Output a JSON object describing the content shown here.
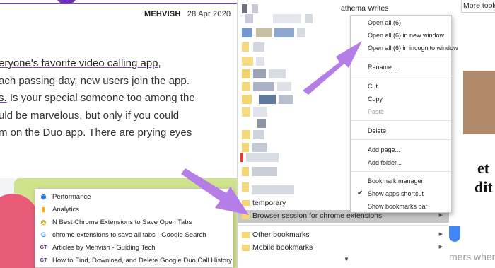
{
  "article": {
    "author": "MEHVISH",
    "date": "28 Apr 2020",
    "lines": [
      "eryone's favorite video calling app,",
      "ach passing day, new users join the app.",
      "s. Is your special someone too among the",
      "uld be marvelous, but only if you could",
      "m on the Duo app. There are prying eyes"
    ]
  },
  "bookmarks_panel": {
    "top_item": "athema Writes",
    "temporary": "temporary",
    "selected_folder": "Browser session for chrome extensions",
    "other": "Other bookmarks",
    "mobile": "Mobile bookmarks",
    "more_arrow": "▼"
  },
  "right_strip": {
    "more_tools": "More tools",
    "big1": "et",
    "big2": "dit",
    "bottom": "mers when"
  },
  "context_menu": {
    "open_all": "Open all (6)",
    "open_all_window": "Open all (6) in new window",
    "open_all_incognito": "Open all (6) in incognito window",
    "rename": "Rename...",
    "cut": "Cut",
    "copy": "Copy",
    "paste": "Paste",
    "delete": "Delete",
    "add_page": "Add page...",
    "add_folder": "Add folder...",
    "bookmark_manager": "Bookmark manager",
    "show_apps_shortcut": "Show apps shortcut",
    "show_apps_checked": "✔",
    "show_bookmarks_bar": "Show bookmarks bar"
  },
  "flyout": {
    "items": [
      {
        "label": "Performance",
        "icon": "performance-icon",
        "glyph": "◉",
        "color": "#1a73e8"
      },
      {
        "label": "Analytics",
        "icon": "analytics-icon",
        "glyph": "▮",
        "color": "#f9ab00"
      },
      {
        "label": "N Best Chrome Extensions to Save Open Tabs",
        "icon": "guiding-tech-icon",
        "glyph": "◎",
        "color": "#e8a500"
      },
      {
        "label": "chrome extensions to save all tabs - Google Search",
        "icon": "google-icon",
        "glyph": "G",
        "color": "#4285f4"
      },
      {
        "label": "Articles by Mehvish - Guiding Tech",
        "icon": "gt-icon",
        "glyph": "GT",
        "color": "#5b2a86"
      },
      {
        "label": "How to Find, Download, and Delete Google Duo Call History",
        "icon": "gt-icon-2",
        "glyph": "GT",
        "color": "#5b2a86"
      }
    ]
  },
  "colors": {
    "arrow": "#b57ee6",
    "accent": "#7a3fc8",
    "selected": "#c7c7c7"
  }
}
